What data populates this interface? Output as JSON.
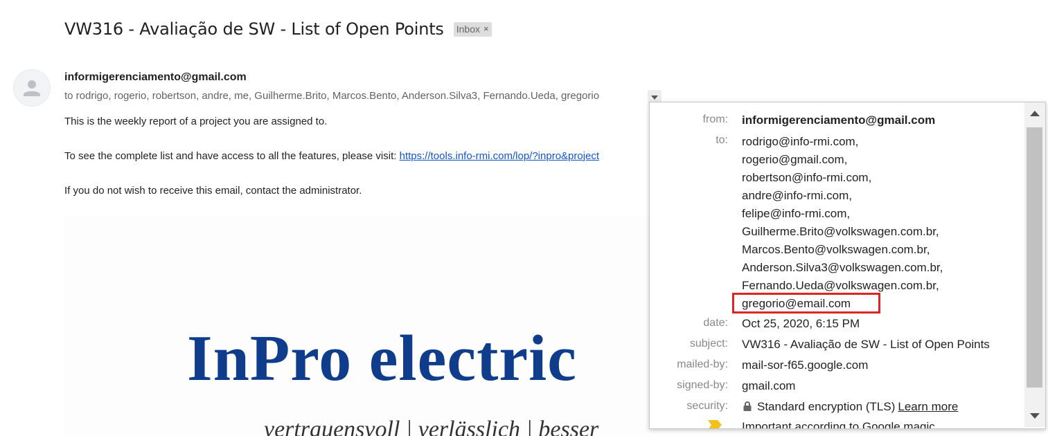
{
  "subject": {
    "title": "VW316 - Avaliação de SW - List of Open Points",
    "label": "Inbox",
    "label_close": "×"
  },
  "message": {
    "sender": "informigerenciamento@gmail.com",
    "recipients_summary": "to rodrigo, rogerio, robertson, andre, me, Guilherme.Brito, Marcos.Bento, Anderson.Silva3, Fernando.Ueda, gregorio",
    "body_line1": "This is the weekly report of a project you are assigned to.",
    "body_line2_prefix": "To see the complete list and have access to all the features, please visit: ",
    "body_link": "https://tools.info-rmi.com/lop/?inpro&project",
    "body_line3": "If you do not wish to receive this email, contact the administrator.",
    "logo_text": "InPro electric",
    "logo_tagline": "vertrauensvoll | verlässlich | besser"
  },
  "details": {
    "from_label": "from:",
    "from_value": "informigerenciamento@gmail.com",
    "to_label": "to:",
    "to_values": [
      "rodrigo@info-rmi.com,",
      "rogerio@gmail.com,",
      "robertson@info-rmi.com,",
      "andre@info-rmi.com,",
      "felipe@info-rmi.com,",
      "Guilherme.Brito@volkswagen.com.br,",
      "Marcos.Bento@volkswagen.com.br,",
      "Anderson.Silva3@volkswagen.com.br,",
      "Fernando.Ueda@volkswagen.com.br,",
      "gregorio@email.com"
    ],
    "date_label": "date:",
    "date_value": "Oct 25, 2020, 6:15 PM",
    "subject_label": "subject:",
    "subject_value": "VW316 - Avaliação de SW - List of Open Points",
    "mailedby_label": "mailed-by:",
    "mailedby_value": "mail-sor-f65.google.com",
    "signedby_label": "signed-by:",
    "signedby_value": "gmail.com",
    "security_label": "security:",
    "security_value": "Standard encryption (TLS)",
    "security_link": "Learn more",
    "important_value": "Important according to Google magic."
  },
  "icons": {
    "avatar": "person-icon",
    "toggle": "caret-down-icon",
    "lock": "lock-icon",
    "important": "important-marker-icon"
  },
  "colors": {
    "link": "#1155cc",
    "highlight": "#e02424",
    "logo_blue": "#0f3d8c",
    "important": "#f2c11c"
  }
}
